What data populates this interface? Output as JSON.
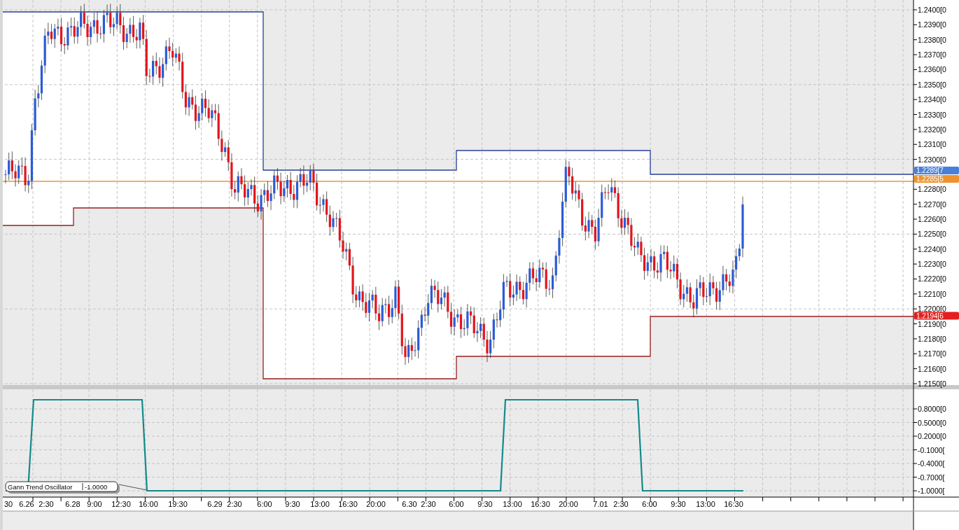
{
  "price_panel": {
    "axis_labels": [
      "1.2400[0",
      "1.2390[0",
      "1.2380[0",
      "1.2370[0",
      "1.2360[0",
      "1.2350[0",
      "1.2340[0",
      "1.2330[0",
      "1.2320[0",
      "1.2310[0",
      "1.2300[0",
      "1.2280[0",
      "1.2270[0",
      "1.2260[0",
      "1.2250[0",
      "1.2240[0",
      "1.2230[0",
      "1.2220[0",
      "1.2210[0",
      "1.2200[0",
      "1.2190[0",
      "1.2180[0",
      "1.2170[0",
      "1.2160[0",
      "1.2150[0"
    ],
    "price_tags": [
      {
        "text": "1.2289[7",
        "color": "#4a7fd8"
      },
      {
        "text": "1.2285[5",
        "color": "#f0922c"
      },
      {
        "text": "1.2194[6",
        "color": "#e41e1e"
      }
    ]
  },
  "oscillator_panel": {
    "legend": {
      "name": "Gann Trend Oscillator",
      "value": "-1.0000"
    },
    "axis_labels": [
      "0.8000[0",
      "0.5000[0",
      "0.2000[0",
      "-0.1000[",
      "-0.4000[",
      "-0.7000[",
      "-1.0000["
    ]
  },
  "time_axis": {
    "labels": [
      "30",
      "6.26",
      "2:30",
      "6.28",
      "9:00",
      "12:30",
      "16:00",
      "19:30",
      "6.29",
      "2:30",
      "6:00",
      "9:30",
      "13:00",
      "16:30",
      "20:00",
      "6.30",
      "2:30",
      "6:00",
      "9:30",
      "13:00",
      "16:30",
      "20:00",
      "7.01",
      "2:30",
      "6:00",
      "9:30",
      "13:00",
      "16:30"
    ]
  }
}
